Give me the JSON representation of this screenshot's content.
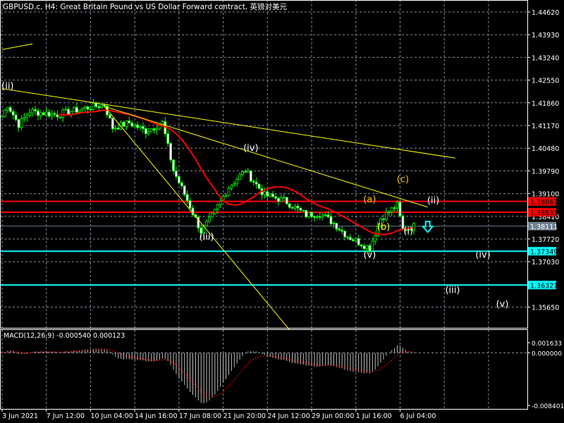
{
  "header": {
    "title": "GBPUSD.c, H4:  Great Britain Pound vs US Dollar Forward contract, 英镑对美元"
  },
  "colors": {
    "bull": "#00ff00",
    "bear_fill": "#ffffff",
    "ma": "#ff0000",
    "trend": "#ffff00",
    "cyan": "#00ffff",
    "grid": "#7f8fa0",
    "axis": "#ffffff"
  },
  "chart_data": {
    "type": "candlestick",
    "symbol": "GBPUSD.c",
    "timeframe": "H4",
    "price_ticks": [
      "1.44620",
      "1.43930",
      "1.43240",
      "1.42550",
      "1.41860",
      "1.41170",
      "1.40480",
      "1.39790",
      "1.39100",
      "1.38410",
      "1.37720",
      "1.37030",
      "1.35650"
    ],
    "time_ticks": [
      "3 Jun 2021",
      "7 Jun 12:00",
      "10 Jun 04:00",
      "14 Jun 16:00",
      "17 Jun 08:00",
      "21 Jun 20:00",
      "24 Jun 12:00",
      "29 Jun 00:00",
      "1 Jul 16:00",
      "6 Jul 04:00"
    ],
    "ylim": [
      1.348,
      1.45
    ],
    "bars_per_time_tick": 16,
    "price_path": [
      [
        0,
        1.4145
      ],
      [
        2,
        1.418
      ],
      [
        6,
        1.412
      ],
      [
        10,
        1.416
      ],
      [
        20,
        1.415
      ],
      [
        30,
        1.417
      ],
      [
        37,
        1.418
      ],
      [
        40,
        1.411
      ],
      [
        46,
        1.4125
      ],
      [
        52,
        1.41
      ],
      [
        58,
        1.4125
      ],
      [
        62,
        1.398
      ],
      [
        67,
        1.389
      ],
      [
        72,
        1.3795
      ],
      [
        76,
        1.384
      ],
      [
        82,
        1.393
      ],
      [
        88,
        1.398
      ],
      [
        95,
        1.3905
      ],
      [
        102,
        1.389
      ],
      [
        110,
        1.3845
      ],
      [
        115,
        1.385
      ],
      [
        120,
        1.382
      ],
      [
        125,
        1.378
      ],
      [
        133,
        1.3745
      ],
      [
        137,
        1.3835
      ],
      [
        143,
        1.3875
      ],
      [
        145,
        1.38
      ],
      [
        149,
        1.3811
      ]
    ],
    "ma_period": 21,
    "price_levels": [
      {
        "value": "1.38863",
        "color": "#ff0000"
      },
      {
        "value": "1.38533",
        "color": "#ff0000"
      },
      {
        "value": "1.38111",
        "color": "#708090"
      },
      {
        "value": "1.37349",
        "color": "#00ffff"
      },
      {
        "value": "1.36321",
        "color": "#00ffff"
      }
    ],
    "trendlines": [
      {
        "from": [
          0,
          1.4348
        ],
        "to": [
          11,
          1.4365
        ]
      },
      {
        "from": [
          0,
          1.4229
        ],
        "to": [
          164,
          1.4018
        ]
      },
      {
        "from": [
          37,
          1.4175
        ],
        "to": [
          154,
          1.3869
        ]
      },
      {
        "from": [
          37,
          1.4175
        ],
        "to": [
          104,
          1.3496
        ]
      }
    ],
    "wave_labels": [
      {
        "text": "(ii)",
        "bar": 2,
        "price": 1.4228,
        "color": "#ffffff"
      },
      {
        "text": "(iii)",
        "bar": 74,
        "price": 1.377,
        "color": "#ffffff"
      },
      {
        "text": "(iv)",
        "bar": 90,
        "price": 1.404,
        "color": "#ffffff"
      },
      {
        "text": "(v)",
        "bar": 133,
        "price": 1.3715,
        "color": "#ffffff"
      },
      {
        "text": "(a)",
        "bar": 133,
        "price": 1.3883,
        "color": "#ffcc00"
      },
      {
        "text": "(b)",
        "bar": 138,
        "price": 1.38,
        "color": "#ffff00"
      },
      {
        "text": "(c)",
        "bar": 145,
        "price": 1.3944,
        "color": "#ffcc00"
      },
      {
        "text": "(i)",
        "bar": 147,
        "price": 1.3788,
        "color": "#ffffff"
      },
      {
        "text": "(ii)",
        "bar": 156,
        "price": 1.388,
        "color": "#ffffff"
      },
      {
        "text": "(iv)",
        "bar": 174,
        "price": 1.3715,
        "color": "#ffffff"
      },
      {
        "text": "(iii)",
        "bar": 163,
        "price": 1.3608,
        "color": "#ffffff"
      },
      {
        "text": "(v)",
        "bar": 181,
        "price": 1.3565,
        "color": "#ffffff"
      }
    ],
    "signal_arrow": {
      "type": "down",
      "bar": 154,
      "price": 1.381,
      "color": "#00ffff"
    },
    "macd": {
      "label": "MACD(12,26,9) -0.000540 0.000123",
      "params": [
        12,
        26,
        9
      ],
      "ticks": [
        "0.001633",
        "0.000000",
        "-0.008401"
      ],
      "ylim": [
        -0.008401,
        0.001633
      ]
    }
  }
}
